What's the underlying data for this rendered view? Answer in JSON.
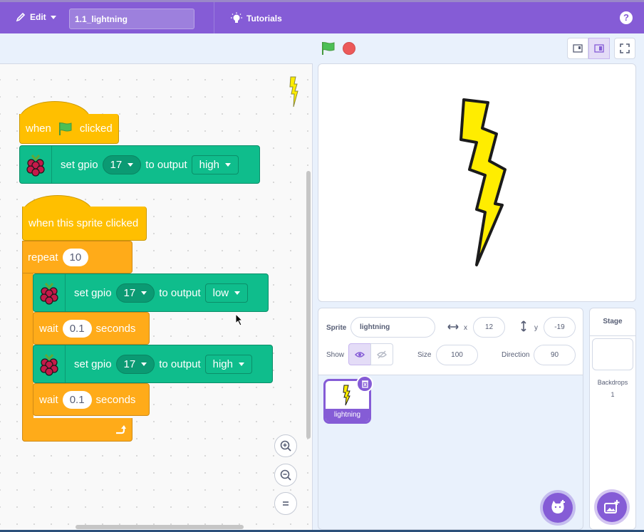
{
  "menu": {
    "edit_label": "Edit",
    "project_title": "1.1_lightning",
    "tutorials_label": "Tutorials",
    "help_label": "?"
  },
  "blocks": {
    "script1": {
      "when": "when",
      "clicked": "clicked",
      "set_gpio": "set gpio",
      "pin": "17",
      "to_output": "to output",
      "level": "high"
    },
    "script2": {
      "hat": "when this sprite clicked",
      "repeat": "repeat",
      "repeat_count": "10",
      "set1": {
        "set_gpio": "set gpio",
        "pin": "17",
        "to_output": "to output",
        "level": "low"
      },
      "wait1": {
        "wait": "wait",
        "value": "0.1",
        "seconds": "seconds"
      },
      "set2": {
        "set_gpio": "set gpio",
        "pin": "17",
        "to_output": "to output",
        "level": "high"
      },
      "wait2": {
        "wait": "wait",
        "value": "0.1",
        "seconds": "seconds"
      }
    }
  },
  "sprite_info": {
    "sprite_label": "Sprite",
    "sprite_name": "lightning",
    "x_label": "x",
    "x_value": "12",
    "y_label": "y",
    "y_value": "-19",
    "show_label": "Show",
    "size_label": "Size",
    "size_value": "100",
    "direction_label": "Direction",
    "direction_value": "90"
  },
  "sprites": [
    {
      "name": "lightning",
      "selected": true
    }
  ],
  "stage_pane": {
    "title": "Stage",
    "backdrops_label": "Backdrops",
    "backdrops_count": "1"
  },
  "colors": {
    "menu_bar": "#855cd6",
    "event_block": "#ffbf00",
    "control_block": "#ffab19",
    "extension_block": "#0fbd8c",
    "lightning_yellow": "#ffed00"
  }
}
